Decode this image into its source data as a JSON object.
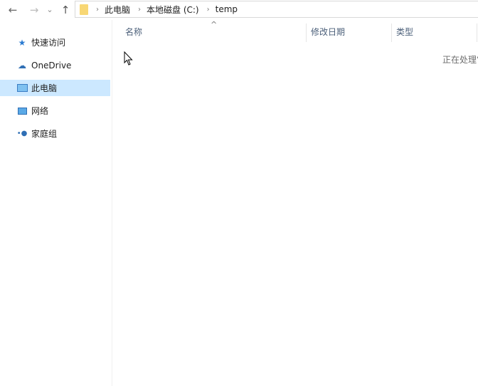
{
  "nav": {
    "back": "←",
    "forward": "→",
    "recent": "⌄",
    "up": "↑"
  },
  "breadcrumb": [
    "此电脑",
    "本地磁盘 (C:)",
    "temp"
  ],
  "sidebar": {
    "items": [
      {
        "label": "快速访问",
        "icon": "star-icon"
      },
      {
        "label": "OneDrive",
        "icon": "cloud-icon"
      },
      {
        "label": "此电脑",
        "icon": "computer-icon",
        "selected": true
      },
      {
        "label": "网络",
        "icon": "network-icon"
      },
      {
        "label": "家庭组",
        "icon": "homegroup-icon"
      }
    ]
  },
  "columns": {
    "name": "名称",
    "modified": "修改日期",
    "type": "类型",
    "sort_indicator": "^"
  },
  "status": "正在处理它..."
}
